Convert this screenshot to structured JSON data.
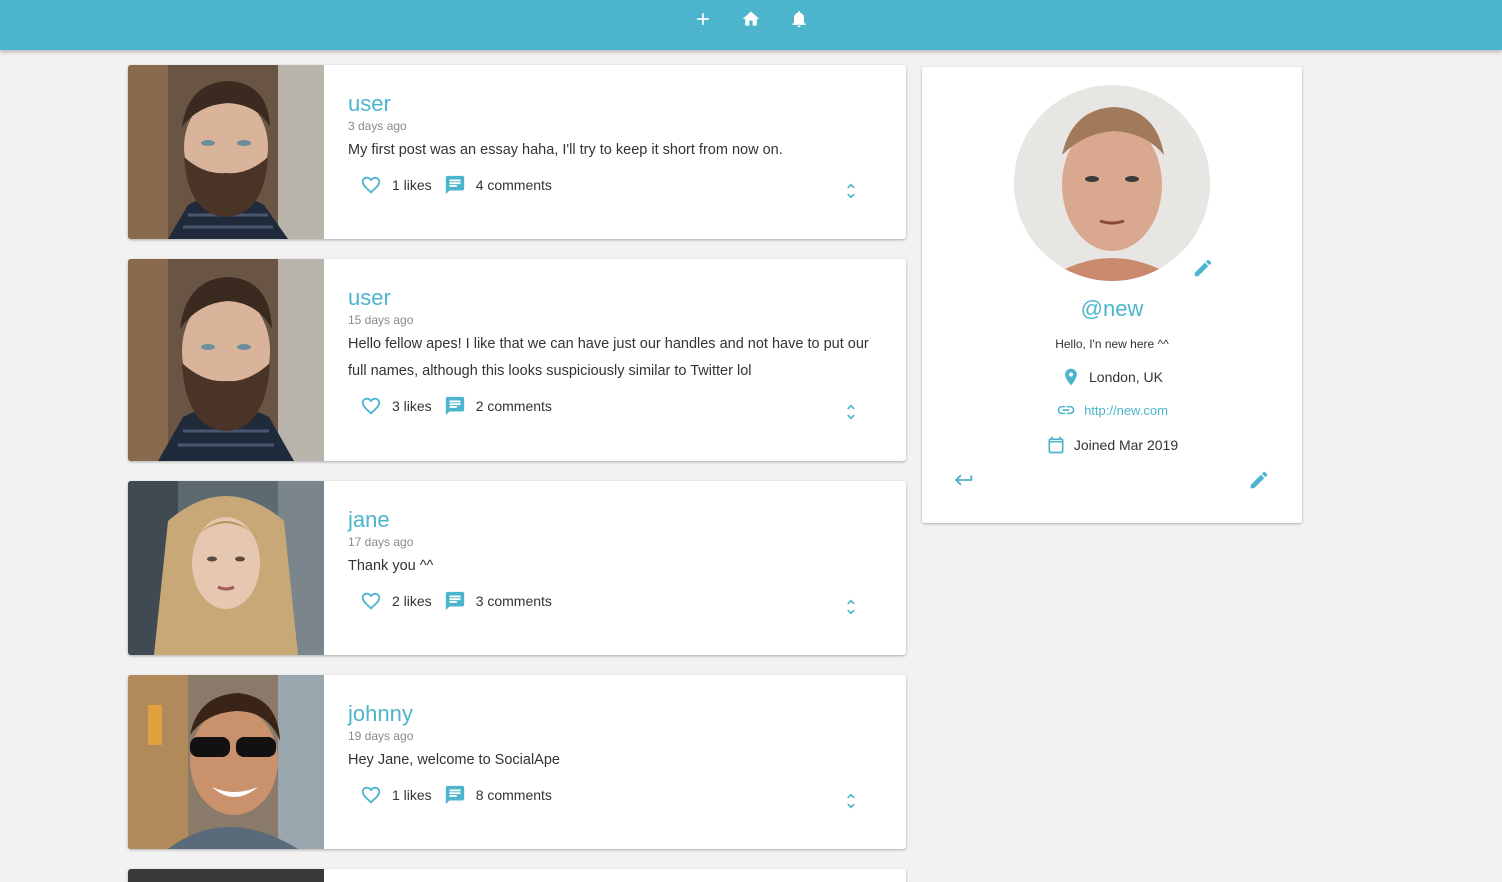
{
  "navbar": {
    "icons": [
      "add-icon",
      "home-icon",
      "notifications-icon"
    ],
    "color": "#4cb5cd"
  },
  "posts": [
    {
      "handle": "user",
      "date": "3 days ago",
      "body": "My first post was an essay haha, I'll try to keep it short from now on.",
      "likes": "1 likes",
      "comments": "4 comments"
    },
    {
      "handle": "user",
      "date": "15 days ago",
      "body": "Hello fellow apes! I like that we can have just our handles and not have to put our full names, although this looks suspiciously similar to Twitter lol",
      "likes": "3 likes",
      "comments": "2 comments"
    },
    {
      "handle": "jane",
      "date": "17 days ago",
      "body": "Thank you ^^",
      "likes": "2 likes",
      "comments": "3 comments"
    },
    {
      "handle": "johnny",
      "date": "19 days ago",
      "body": "Hey Jane, welcome to SocialApe",
      "likes": "1 likes",
      "comments": "8 comments"
    }
  ],
  "profile": {
    "handle": "@new",
    "bio": "Hello, I'n new here ^^",
    "location": "London, UK",
    "website": "http://new.com",
    "joined": "Joined Mar 2019"
  },
  "accent_color": "#4cb5cd"
}
